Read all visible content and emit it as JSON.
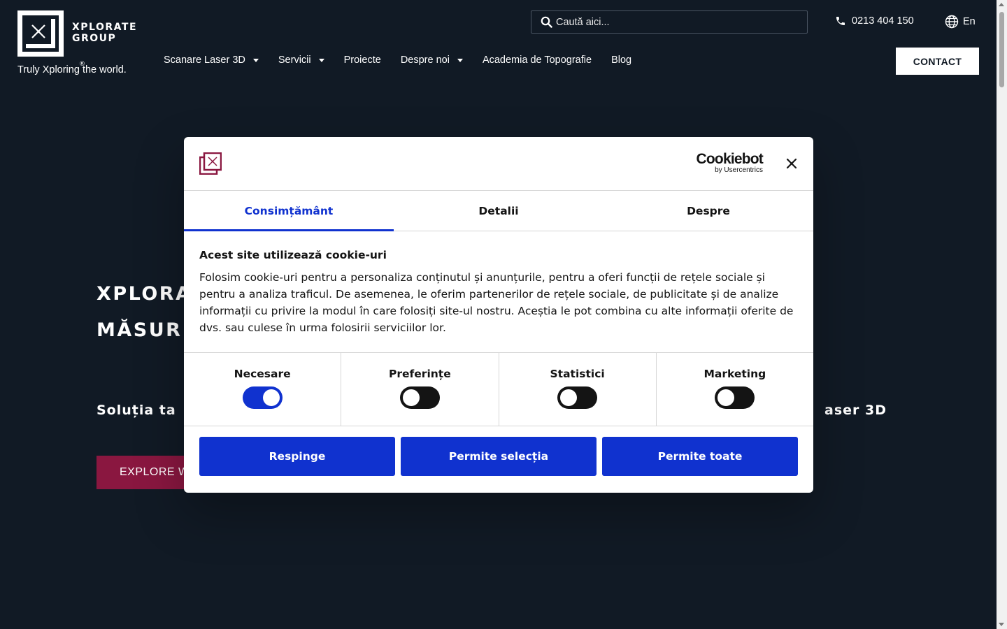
{
  "header": {
    "logo_line1": "XPLORATE",
    "logo_line2": "GROUP",
    "logo_reg": "®",
    "tagline": "Truly Xploring the world.",
    "search_placeholder": "Caută aici...",
    "phone": "0213 404 150",
    "language": "En",
    "contact_label": "CONTACT"
  },
  "nav": {
    "items": [
      {
        "label": "Scanare Laser 3D",
        "dropdown": true
      },
      {
        "label": "Servicii",
        "dropdown": true
      },
      {
        "label": "Proiecte",
        "dropdown": false
      },
      {
        "label": "Despre noi",
        "dropdown": true
      },
      {
        "label": "Academia de Topografie",
        "dropdown": false
      },
      {
        "label": "Blog",
        "dropdown": false
      }
    ]
  },
  "hero": {
    "title_line1": "XPLORA",
    "title_line2": "MĂSUR",
    "subtitle_left": "Soluția ta",
    "subtitle_right": "aser 3D",
    "explore_label": "EXPLORE W"
  },
  "cookie": {
    "brand": "Cookiebot",
    "brand_by": "by Usercentrics",
    "tabs": [
      "Consimțământ",
      "Detalii",
      "Despre"
    ],
    "active_tab": "Consimțământ",
    "heading": "Acest site utilizează cookie-uri",
    "body": "Folosim cookie-uri pentru a personaliza conținutul și anunțurile, pentru a oferi funcții de rețele sociale și pentru a analiza traficul. De asemenea, le oferim partenerilor de rețele sociale, de publicitate și de analize informații cu privire la modul în care folosiți site-ul nostru. Aceștia le pot combina cu alte informații oferite de dvs. sau culese în urma folosirii serviciilor lor.",
    "toggles": [
      {
        "label": "Necesare",
        "on": true
      },
      {
        "label": "Preferințe",
        "on": false
      },
      {
        "label": "Statistici",
        "on": false
      },
      {
        "label": "Marketing",
        "on": false
      }
    ],
    "buttons": {
      "reject": "Respinge",
      "allow_selection": "Permite selecția",
      "allow_all": "Permite toate"
    }
  },
  "colors": {
    "background": "#111a25",
    "accent_blue": "#1032cf",
    "brand_red": "#8a1740"
  }
}
